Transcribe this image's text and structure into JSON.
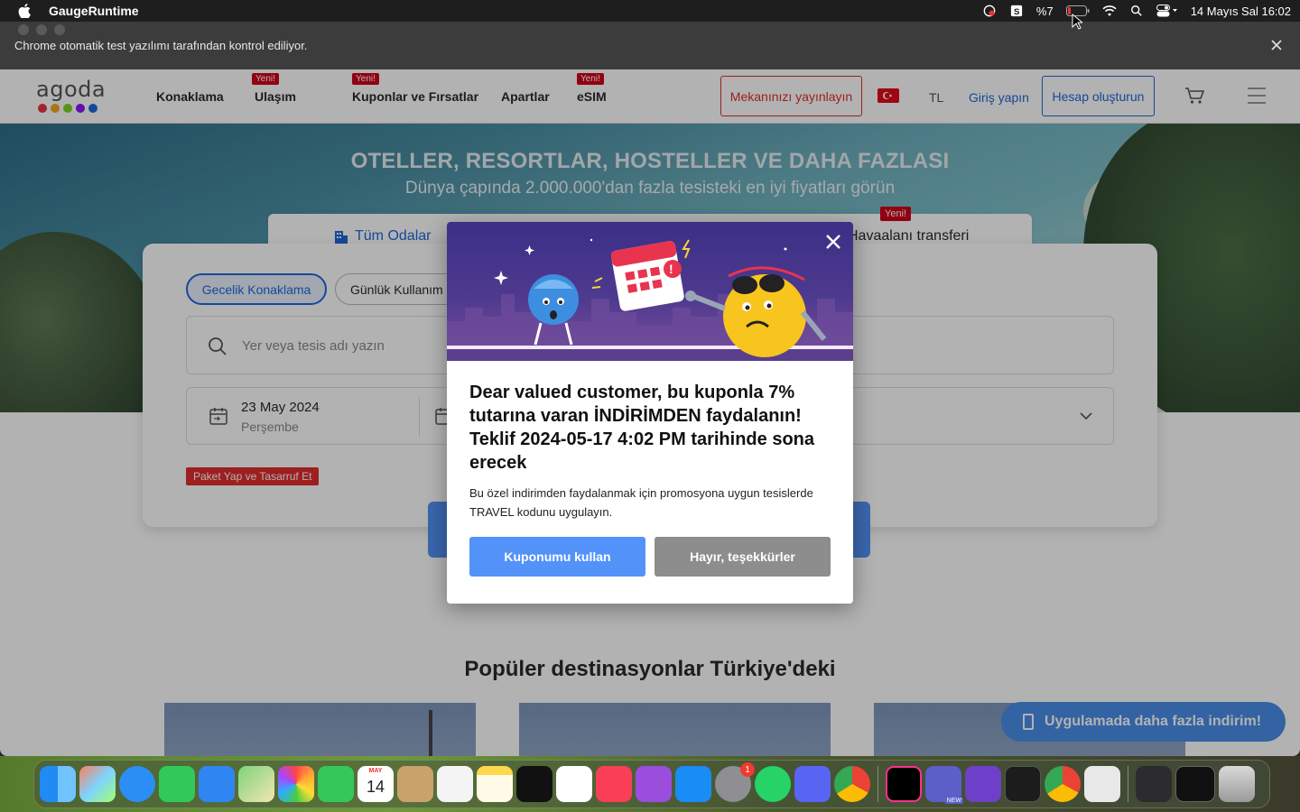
{
  "menubar": {
    "app_name": "GaugeRuntime",
    "battery": "%7",
    "datetime": "14 Mayıs Sal  16:02"
  },
  "browser": {
    "automation_notice": "Chrome otomatik test yazılımı tarafından kontrol ediliyor."
  },
  "header": {
    "nav": [
      {
        "label": "Konaklama",
        "badge": ""
      },
      {
        "label": "Ulaşım",
        "badge": "Yeni!"
      },
      {
        "label": "Kuponlar ve Fırsatlar",
        "badge": "Yeni!"
      },
      {
        "label": "Apartlar",
        "badge": ""
      },
      {
        "label": "eSIM",
        "badge": "Yeni!"
      }
    ],
    "list_property": "Mekanınızı yayınlayın",
    "currency": "TL",
    "login": "Giriş yapın",
    "create_account": "Hesap oluşturun",
    "logo_text": "agoda",
    "logo_colors": [
      "#e8343f",
      "#f5a623",
      "#7ed321",
      "#9013fe",
      "#2067da"
    ]
  },
  "hero": {
    "title": "OTELLER, RESORTLAR, HOSTELLER VE DAHA FAZLASI",
    "subtitle": "Dünya çapında 2.000.000'dan fazla tesisteki en iyi fiyatları görün"
  },
  "search": {
    "tab_all_rooms": "Tüm Odalar",
    "tab_airport": "Havaalanı transferi",
    "tab_airport_badge": "Yeni!",
    "pill_overnight": "Gecelik Konaklama",
    "pill_day_use": "Günlük Kullanım",
    "placeholder": "Yer veya tesis adı yazın",
    "checkin_date": "23 May 2024",
    "checkin_day": "Perşembe",
    "package_badge": "Paket Yap ve Tasarruf Et"
  },
  "popular": {
    "title": "Popüler destinasyonlar Türkiye'deki"
  },
  "app_banner": "Uygulamada daha fazla indirim!",
  "modal": {
    "title": "Dear valued customer, bu kuponla 7% tutarına varan İNDİRİMDEN faydalanın! Teklif 2024-05-17  4:02 PM tarihinde sona erecek",
    "body": "Bu özel indirimden faydalanmak için promosyona uygun tesislerde TRAVEL kodunu uygulayın.",
    "use_button": "Kuponumu kullan",
    "decline_button": "Hayır, teşekkürler"
  },
  "dock": {
    "calendar_month": "MAY",
    "calendar_day": "14",
    "settings_badge": "1",
    "teams_badge": "NEW",
    "apps": [
      "finder",
      "launchpad",
      "safari",
      "messages",
      "mail",
      "maps",
      "photos",
      "facetime",
      "calendar",
      "contacts",
      "reminders",
      "notes",
      "apple-tv",
      "freeform",
      "music",
      "podcasts",
      "app-store",
      "system-settings",
      "whatsapp",
      "discord",
      "chrome",
      "intellij",
      "teams",
      "github-desktop",
      "terminal",
      "chrome",
      "preview",
      "downloads",
      "window",
      "trash"
    ]
  },
  "colors": {
    "accent_blue": "#2067da",
    "button_blue": "#5392f9",
    "badge_red": "#d0021b",
    "decline_gray": "#8d8d8d"
  }
}
